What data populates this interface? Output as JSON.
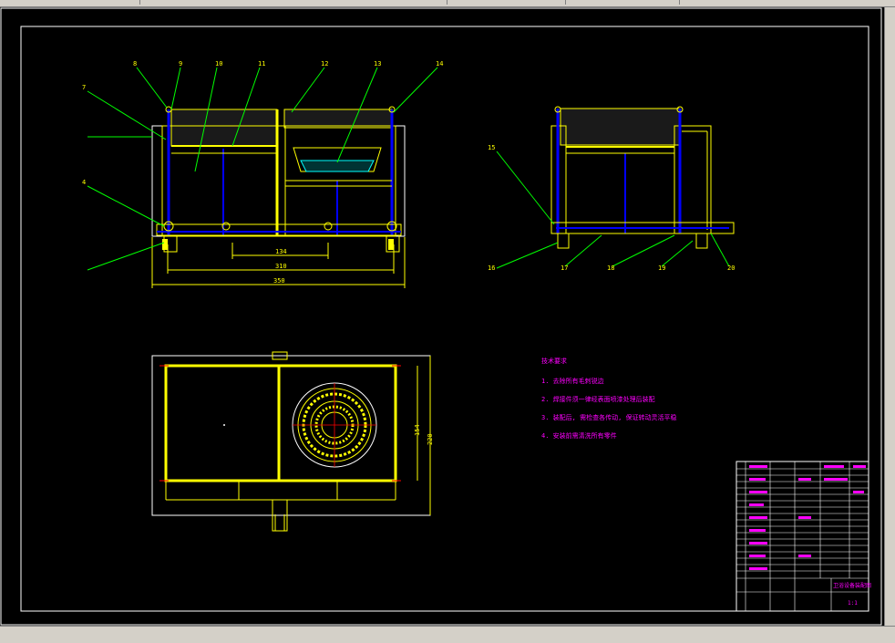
{
  "drawing": {
    "dimensions": [
      "134",
      "310",
      "350",
      "154",
      "220"
    ],
    "part_labels": [
      "8",
      "9",
      "10",
      "11",
      "12",
      "13",
      "14",
      "7",
      "4",
      "15",
      "16",
      "17",
      "18",
      "19",
      "20"
    ]
  },
  "notes": {
    "title": "技术要求",
    "items": [
      "1. 去除所有毛刺锐边",
      "2. 焊接件须一律经表面喷漆处理后装配",
      "3. 装配后, 需检查各传动, 保证转动灵活平稳",
      "4. 安装前需清洗所有零件"
    ]
  },
  "title_block": {
    "drawing_name": "卫浴设备装配图",
    "sheet": "1:1"
  },
  "colors": {
    "frame": "#ffffff",
    "outline": "#ffff00",
    "hidden": "#0000ff",
    "leader": "#00ff00",
    "notes": "#ff00ff",
    "hatch": "#00ffff"
  }
}
